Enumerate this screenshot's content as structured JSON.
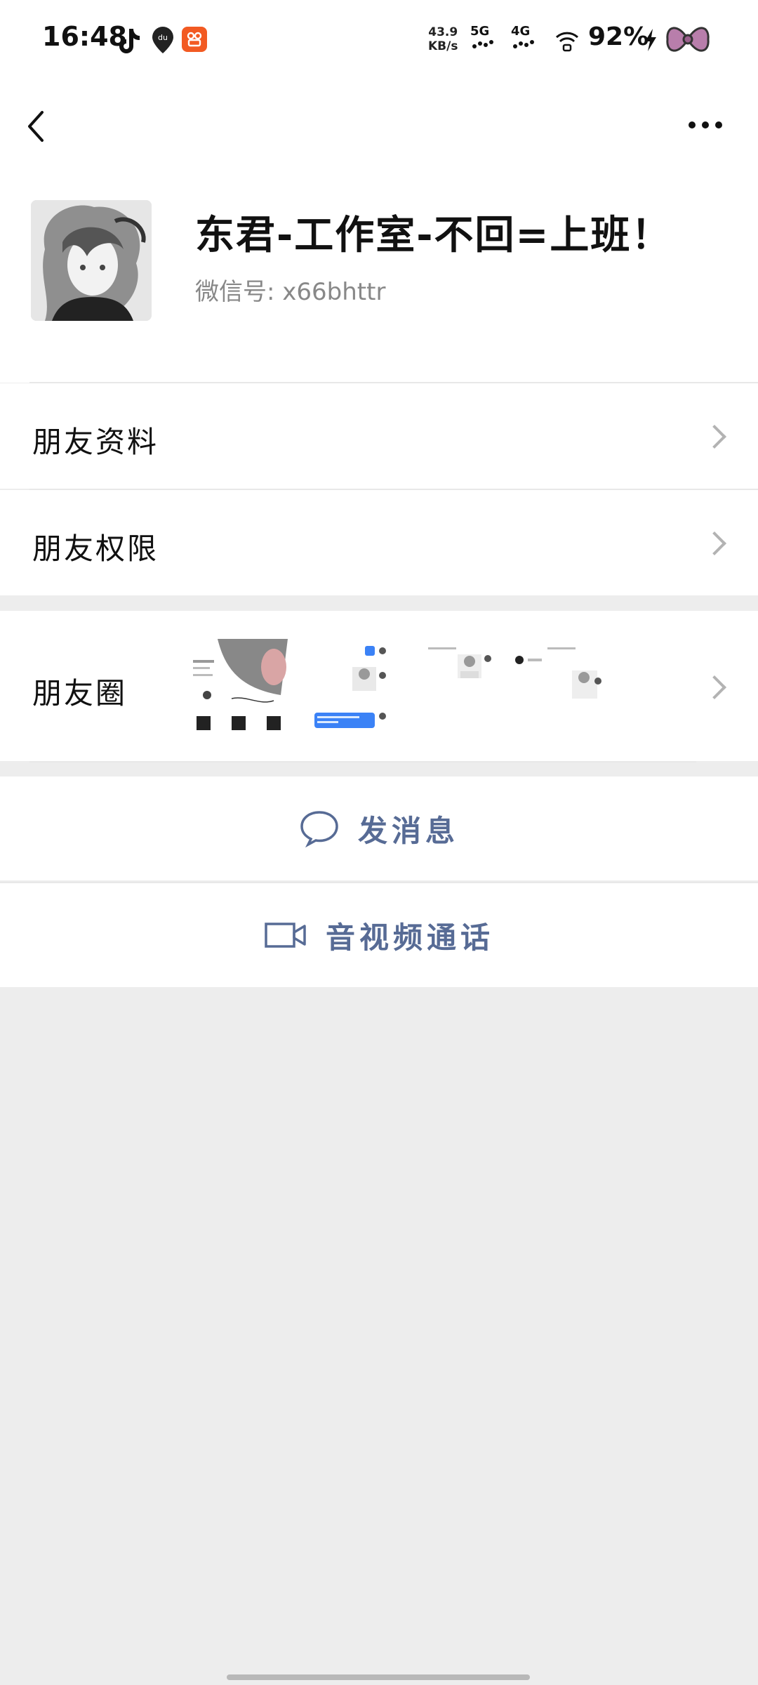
{
  "status_bar": {
    "time": "16:48",
    "net_speed_value": "43.9",
    "net_speed_unit": "KB/s",
    "sig1": "5G",
    "sig2": "4G",
    "battery": "92%",
    "icons": [
      "tiktok-icon",
      "du-map-icon",
      "app-icon",
      "wifi-icon",
      "charging-icon",
      "bow-icon"
    ]
  },
  "nav": {
    "back_icon": "chevron-left-icon",
    "more_icon": "more-dots-icon"
  },
  "profile": {
    "name": "东君-工作室-不回=上班！",
    "wechat_id": "微信号: x66bhttr"
  },
  "rows": {
    "friend_info": "朋友资料",
    "friend_permission": "朋友权限",
    "moments": "朋友圈"
  },
  "actions": {
    "send_message": "发消息",
    "video_call": "音视频通话"
  },
  "colors": {
    "accent": "#576b95",
    "background": "#ededed",
    "card": "#ffffff"
  }
}
